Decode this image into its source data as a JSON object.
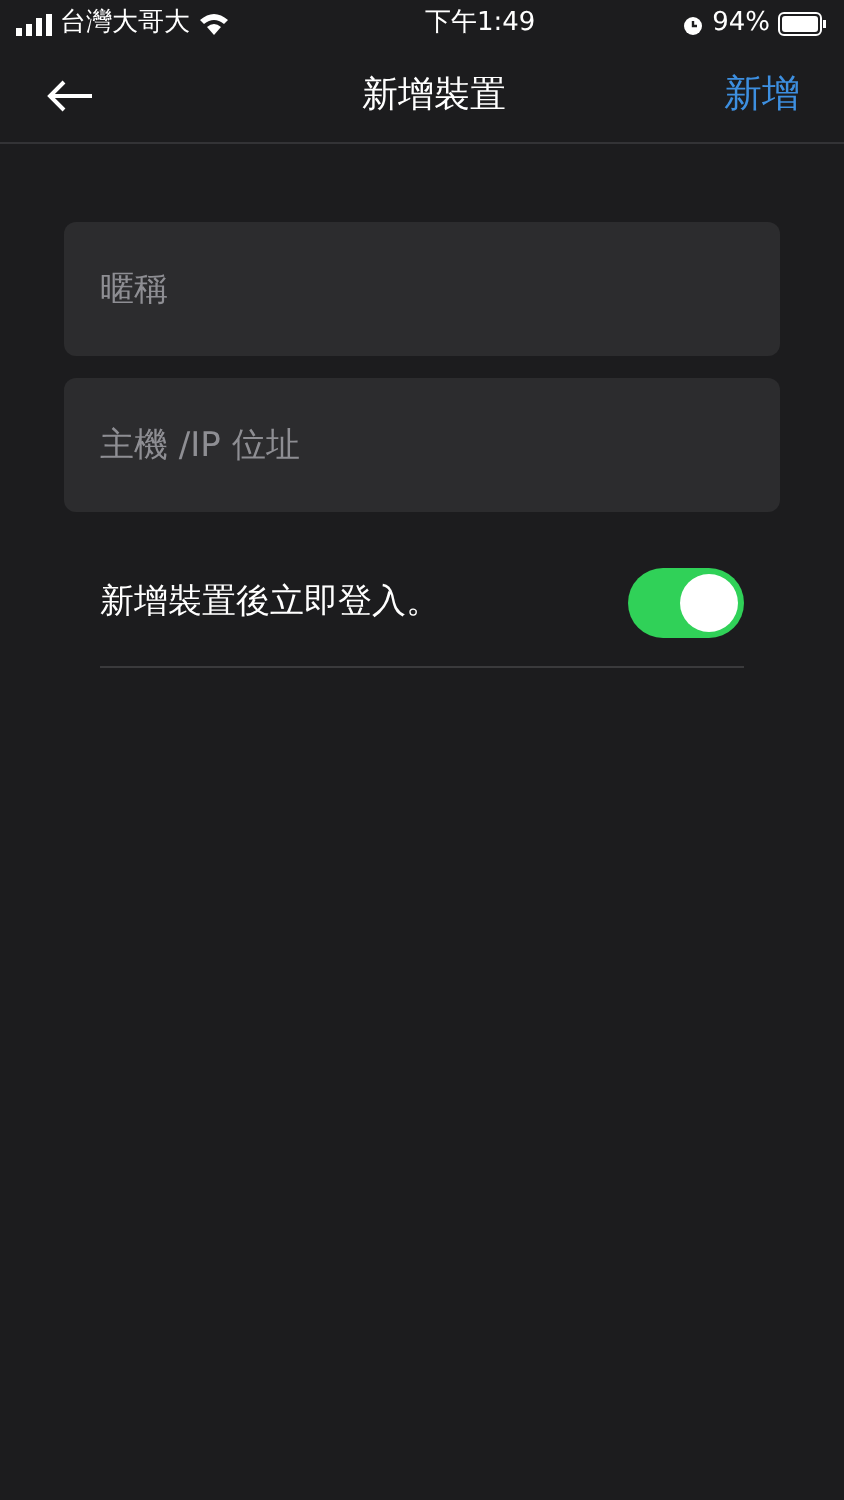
{
  "status_bar": {
    "carrier": "台灣大哥大",
    "time": "下午1:49",
    "battery": "94%"
  },
  "nav_bar": {
    "title": "新增裝置",
    "action": "新增"
  },
  "fields": [
    {
      "placeholder": "暱稱"
    },
    {
      "placeholder": "主機 /IP 位址"
    }
  ],
  "login_toggle": {
    "label": "新增裝置後立即登入。",
    "on": true
  }
}
